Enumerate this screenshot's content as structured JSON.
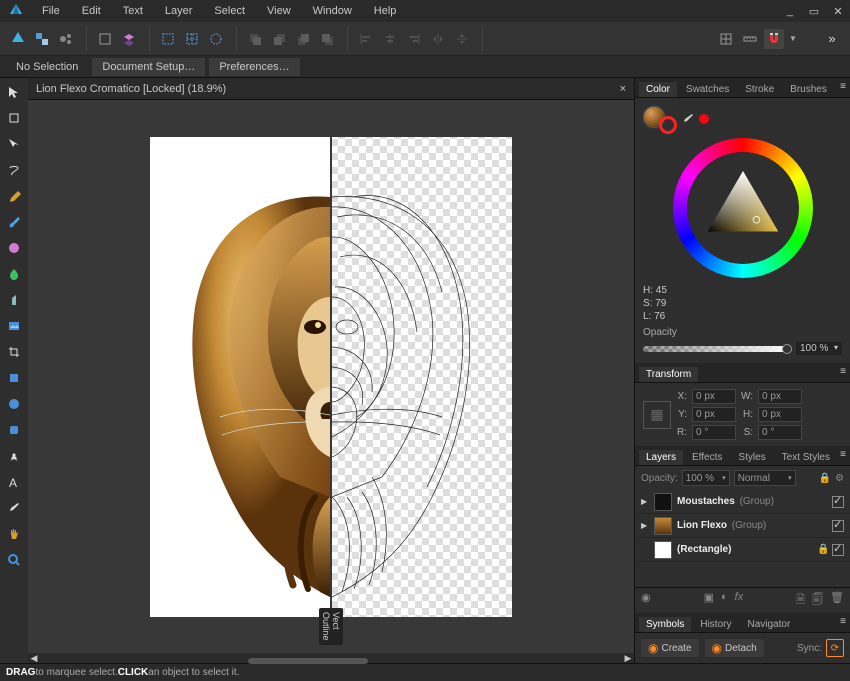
{
  "menu": [
    "File",
    "Edit",
    "Text",
    "Layer",
    "Select",
    "View",
    "Window",
    "Help"
  ],
  "window_ctl": {
    "min": "_",
    "max": "▭",
    "close": "✕"
  },
  "selection_label": "No Selection",
  "top_buttons": {
    "doc_setup": "Document Setup…",
    "prefs": "Preferences…"
  },
  "toolbar_more": "»",
  "document": {
    "title": "Lion Flexo Cromatico [Locked] (18.9%)",
    "close": "×",
    "split_labels": {
      "left": "Vect",
      "right": "Outline"
    }
  },
  "panels": {
    "color_tabs": [
      "Color",
      "Swatches",
      "Stroke",
      "Brushes"
    ],
    "hsl": {
      "h": "H: 45",
      "s": "S: 79",
      "l": "L: 76"
    },
    "opacity_label": "Opacity",
    "opacity_value": "100 %",
    "transform_tab": "Transform",
    "transform": {
      "x_lbl": "X:",
      "x_val": "0 px",
      "w_lbl": "W:",
      "w_val": "0 px",
      "y_lbl": "Y:",
      "y_val": "0 px",
      "h_lbl": "H:",
      "h_val": "0 px",
      "r_lbl": "R:",
      "r_val": "0 °",
      "s_lbl": "S:",
      "s_val": "0 °"
    },
    "layers_tabs": [
      "Layers",
      "Effects",
      "Styles",
      "Text Styles"
    ],
    "layers_opts": {
      "opacity_lbl": "Opacity:",
      "opacity": "100 %",
      "blend": "Normal"
    },
    "layers": [
      {
        "name": "Moustaches",
        "type": "(Group)",
        "expand": "▶",
        "thumb": "dark",
        "checked": true,
        "locked": false
      },
      {
        "name": "Lion Flexo",
        "type": "(Group)",
        "expand": "▶",
        "thumb": "lion",
        "checked": true,
        "locked": false
      },
      {
        "name": "(Rectangle)",
        "type": "",
        "expand": "",
        "thumb": "white",
        "checked": true,
        "locked": true
      }
    ],
    "sym_tabs": [
      "Symbols",
      "History",
      "Navigator"
    ],
    "sym": {
      "create": "Create",
      "detach": "Detach",
      "sync": "Sync:"
    }
  },
  "status_hint": {
    "t1": "DRAG",
    "t2": " to marquee select. ",
    "t3": "CLICK",
    "t4": " an object to select it."
  }
}
